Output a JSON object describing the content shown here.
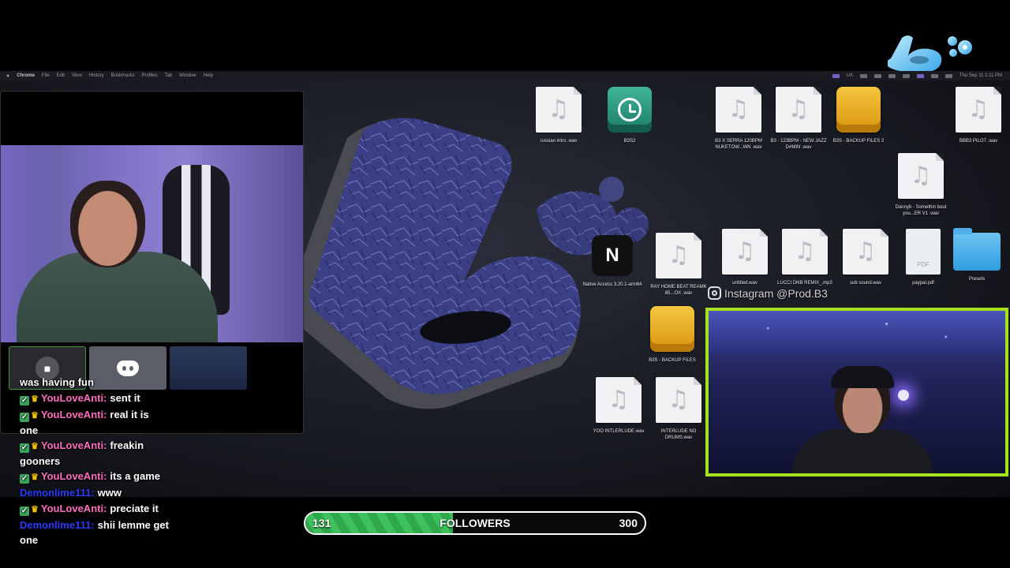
{
  "menubar": {
    "app": "Chrome",
    "items": [
      "File",
      "Edit",
      "View",
      "History",
      "Bookmarks",
      "Profiles",
      "Tab",
      "Window",
      "Help"
    ],
    "clock": "Thu Sep 11 1:11 PM",
    "status_text": "UA"
  },
  "desktop_icons": [
    {
      "label": "russian intro .wav",
      "kind": "audio"
    },
    {
      "label": "B3S2",
      "kind": "time-machine"
    },
    {
      "label": "B3 X SERRA 120BPM NUKETOW...WN .wav",
      "kind": "audio"
    },
    {
      "label": "B3 - 123BPM - NEW JAZZ D#MIN .wav",
      "kind": "audio"
    },
    {
      "label": "B3S - BACKUP FILES 2",
      "kind": "drive"
    },
    {
      "label": "BBB3 PILOT .wav",
      "kind": "audio"
    },
    {
      "label": "Dannyb - Somethin bout you...ER V1 .wav",
      "kind": "audio"
    },
    {
      "label": "Native Access 3.20.1-arm64",
      "kind": "app"
    },
    {
      "label": "RAY HOME BEAT REAMK 85...OX .wav",
      "kind": "audio"
    },
    {
      "label": "untitled.wav",
      "kind": "audio"
    },
    {
      "label": "LUCCI DNB REMIX_.mp3",
      "kind": "audio"
    },
    {
      "label": "sub sound.wav",
      "kind": "audio"
    },
    {
      "label": "paypal.pdf",
      "kind": "pdf"
    },
    {
      "label": "Presets",
      "kind": "folder"
    },
    {
      "label": "B3S - BACKUP FILES",
      "kind": "drive"
    },
    {
      "label": "YOO INTLERLUDE.wav",
      "kind": "audio"
    },
    {
      "label": "INTERLUDE NO DRUMS.wav",
      "kind": "audio"
    }
  ],
  "native_access_glyph": "N",
  "pdf_badge": "PDF",
  "instagram": {
    "handle": "Instagram @Prod.B3",
    "icon": "instagram-icon"
  },
  "call_tiles": [
    {
      "kind": "camera",
      "icon": "video-camera-icon"
    },
    {
      "kind": "discord",
      "icon": "discord-icon"
    },
    {
      "kind": "video"
    }
  ],
  "chat": [
    {
      "user": "",
      "text": "was having fun",
      "color": "#ffffff"
    },
    {
      "user": "YouLoveAnti:",
      "text": "sent it",
      "color": "#ff6fbf",
      "badges": true
    },
    {
      "user": "YouLoveAnti:",
      "text": "real it is",
      "text2": "one",
      "color": "#ff6fbf",
      "badges": true
    },
    {
      "user": "YouLoveAnti:",
      "text": "freakin",
      "text2": "gooners",
      "color": "#ff6fbf",
      "badges": true
    },
    {
      "user": "YouLoveAnti:",
      "text": "its a game",
      "color": "#ff6fbf",
      "badges": true
    },
    {
      "user": "Demonlime111:",
      "text": "www",
      "color": "#2b3bff"
    },
    {
      "user": "YouLoveAnti:",
      "text": "preciate it",
      "color": "#ff6fbf",
      "badges": true
    },
    {
      "user": "Demonlime111:",
      "text": "shii lemme get",
      "text2": "one",
      "color": "#2b3bff"
    }
  ],
  "followers": {
    "current": "131",
    "label": "FOLLOWERS",
    "goal": "300",
    "progress_fraction": 0.436
  },
  "colors": {
    "accent_green": "#a4e21c",
    "progress_green": "#3ec15c",
    "brand_blue": "#5ec8f4"
  }
}
